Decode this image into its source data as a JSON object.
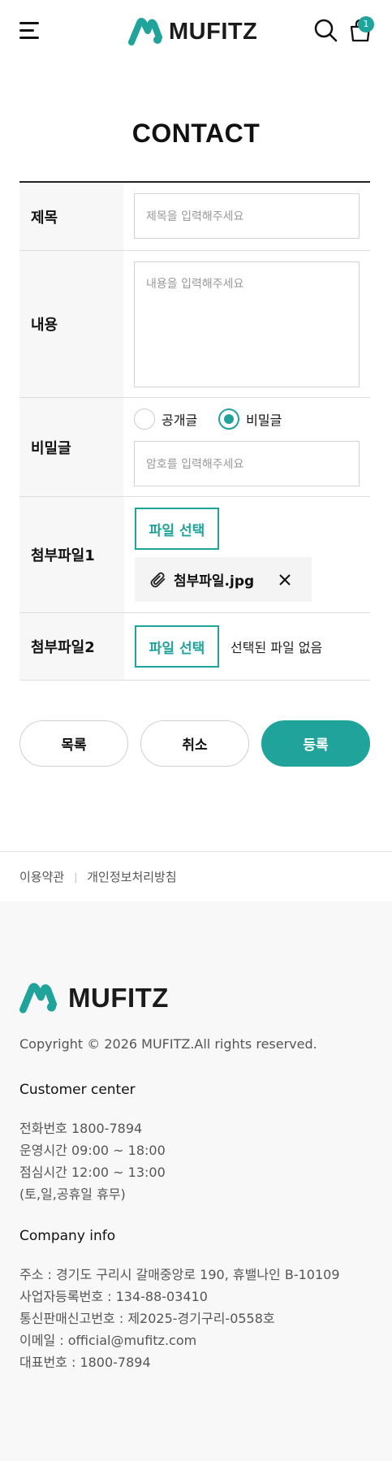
{
  "header": {
    "brand": "MUFITZ",
    "cart_count": "1",
    "brand_color": "#20a39a"
  },
  "page": {
    "title": "CONTACT"
  },
  "form": {
    "title": {
      "label": "제목",
      "placeholder": "제목을 입력해주세요"
    },
    "content": {
      "label": "내용",
      "placeholder": "내용을 입력해주세요"
    },
    "secret": {
      "label": "비밀글",
      "options": [
        "공개글",
        "비밀글"
      ],
      "selected": "비밀글",
      "password_placeholder": "암호를 입력해주세요"
    },
    "file1": {
      "label": "첨부파일1",
      "button": "파일 선택",
      "file_name": "첨부파일.jpg"
    },
    "file2": {
      "label": "첨부파일2",
      "button": "파일 선택",
      "status": "선택된 파일 없음"
    }
  },
  "actions": {
    "list": "목록",
    "cancel": "취소",
    "submit": "등록"
  },
  "footer_links": {
    "terms": "이용약관",
    "privacy": "개인정보처리방침"
  },
  "footer": {
    "brand": "MUFITZ",
    "copyright": "Copyright © 2026 MUFITZ.All rights reserved.",
    "customer_center": {
      "heading": "Customer center",
      "lines": [
        "전화번호 1800-7894",
        "운영시간 09:00 ~ 18:00",
        "점심시간 12:00 ~ 13:00",
        "(토,일,공휴일 휴무)"
      ]
    },
    "company_info": {
      "heading": "Company info",
      "lines": [
        "주소 : 경기도 구리시 갈매중앙로 190, 휴밸나인 B-10109",
        "사업자등록번호 : 134-88-03410",
        "통신판매신고번호 : 제2025-경기구리-0558호",
        "이메일 : official@mufitz.com",
        "대표번호 : 1800-7894"
      ]
    }
  }
}
